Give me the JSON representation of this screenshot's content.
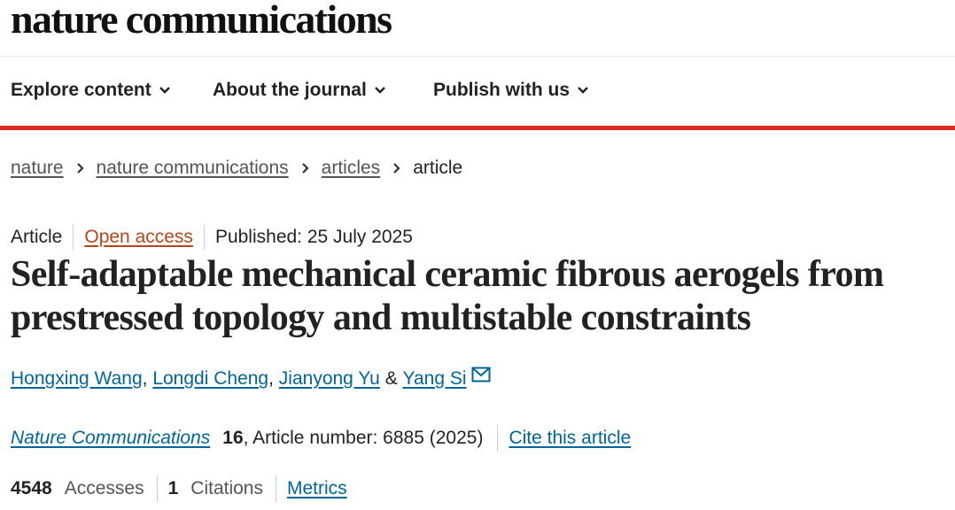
{
  "site": {
    "logo": "nature communications"
  },
  "nav": {
    "items": [
      {
        "label": "Explore content"
      },
      {
        "label": "About the journal"
      },
      {
        "label": "Publish with us"
      }
    ]
  },
  "breadcrumb": {
    "items": [
      "nature",
      "nature communications",
      "articles"
    ],
    "current": "article"
  },
  "article": {
    "type": "Article",
    "access": "Open access",
    "published": "Published: 25 July 2025",
    "title": "Self-adaptable mechanical ceramic fibrous aerogels from prestressed topology and multistable constraints",
    "authors": [
      "Hongxing Wang",
      "Longdi Cheng",
      "Jianyong Yu",
      "Yang Si"
    ],
    "author_separator": ",",
    "author_conjunction": "&",
    "journal": "Nature Communications",
    "volume": "16",
    "article_number": ", Article number: 6885 (2025)",
    "cite_label": "Cite this article",
    "accesses_count": "4548",
    "accesses_label": "Accesses",
    "citations_count": "1",
    "citations_label": "Citations",
    "metrics_label": "Metrics"
  },
  "colors": {
    "accent_red": "#e0291e",
    "link_blue": "#006699",
    "open_access_orange": "#b5461b"
  },
  "icons": {
    "nav_chevron": "chevron-down-icon",
    "breadcrumb_separator": "chevron-right-icon",
    "corresponding_author": "mail-icon"
  }
}
